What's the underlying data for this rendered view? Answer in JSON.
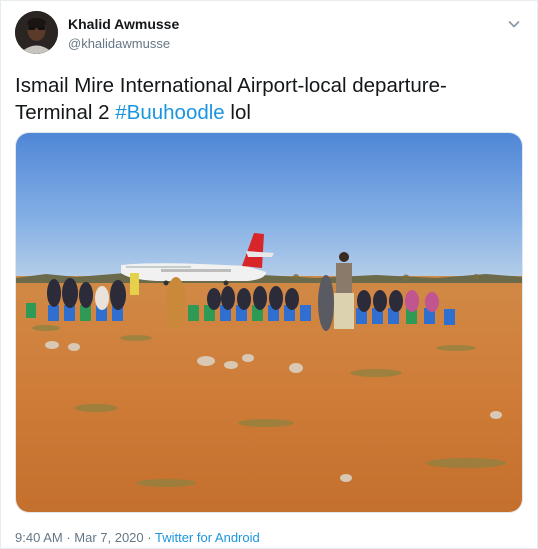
{
  "author": {
    "name": "Khalid Awmusse",
    "handle": "@khalidawmusse"
  },
  "tweet": {
    "text_before": "Ismail Mire International Airport-local departure-Terminal 2 ",
    "hashtag": "#Buuhoodle",
    "text_after": " lol"
  },
  "meta": {
    "time": "9:40 AM",
    "separator_1": " · ",
    "date": "Mar 7, 2020",
    "separator_2": " · ",
    "source": "Twitter for Android"
  },
  "icons": {
    "caret": "chevron-down-icon"
  },
  "colors": {
    "link": "#1b95e0",
    "secondary_text": "#657786",
    "primary_text": "#14171a"
  }
}
